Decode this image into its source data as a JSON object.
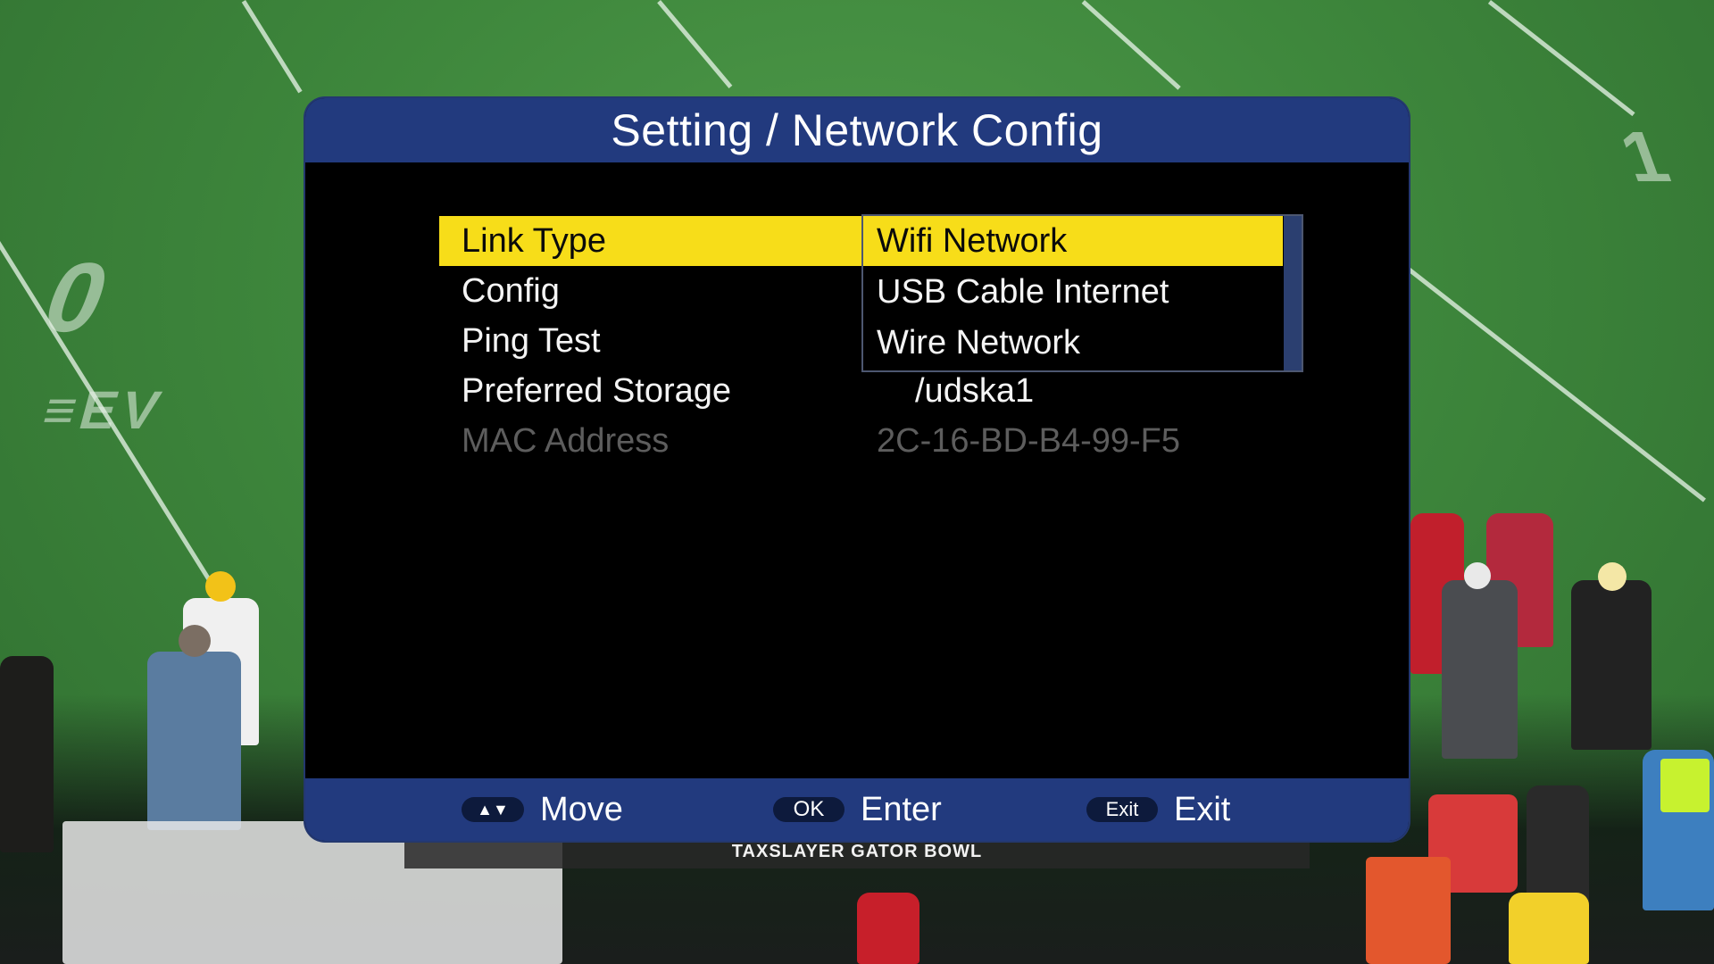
{
  "background": {
    "score_strip_text": "TAXSLAYER GATOR BOWL"
  },
  "dialog": {
    "title": "Setting / Network Config",
    "menu": [
      {
        "label": "Link Type",
        "value": ""
      },
      {
        "label": "Config",
        "value": ""
      },
      {
        "label": "Ping Test",
        "value": ""
      },
      {
        "label": "Preferred Storage",
        "value": "/udska1"
      },
      {
        "label": "MAC Address",
        "value": "2C-16-BD-B4-99-F5"
      }
    ],
    "dropdown": {
      "options": [
        "Wifi Network",
        "USB Cable Internet",
        "Wire Network"
      ],
      "selected": "Wifi Network"
    },
    "footer": {
      "move": {
        "key": "▲▼",
        "label": "Move"
      },
      "enter": {
        "key": "OK",
        "label": "Enter"
      },
      "exit": {
        "key": "Exit",
        "label": "Exit"
      }
    }
  },
  "colors": {
    "header_blue": "#223a7e",
    "highlight_yellow": "#f7dd19",
    "disabled_gray": "#5d5d5d"
  }
}
